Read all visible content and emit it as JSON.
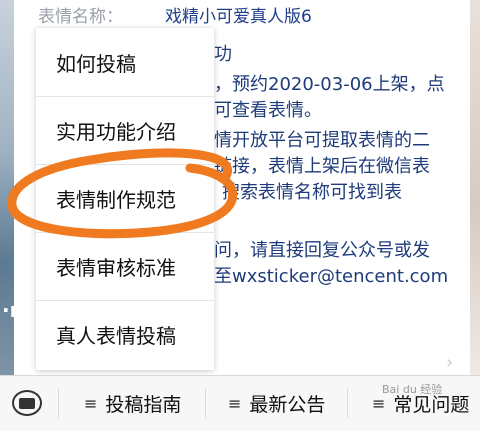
{
  "info": {
    "label": "表情名称：",
    "value": "戏精小可爱真人版6",
    "lines": [
      "功",
      "，预约2020-03-06上架，点",
      "可查看表情。",
      "情开放平台可提取表情的二",
      "链接，表情上架后在微信表",
      "搜索表情名称可找到表",
      "问，请直接回复公众号或发",
      "至wxsticker@tencent.com"
    ]
  },
  "menu": {
    "items": [
      {
        "label": "如何投稿"
      },
      {
        "label": "实用功能介绍"
      },
      {
        "label": "表情制作规范"
      },
      {
        "label": "表情审核标准"
      },
      {
        "label": "真人表情投稿"
      }
    ]
  },
  "bottom_bar": {
    "tabs": [
      {
        "label": "投稿指南"
      },
      {
        "label": "最新公告"
      },
      {
        "label": "常见问题"
      }
    ]
  },
  "highlight_color": "#f07a1f",
  "watermark": "Bai du 经验"
}
